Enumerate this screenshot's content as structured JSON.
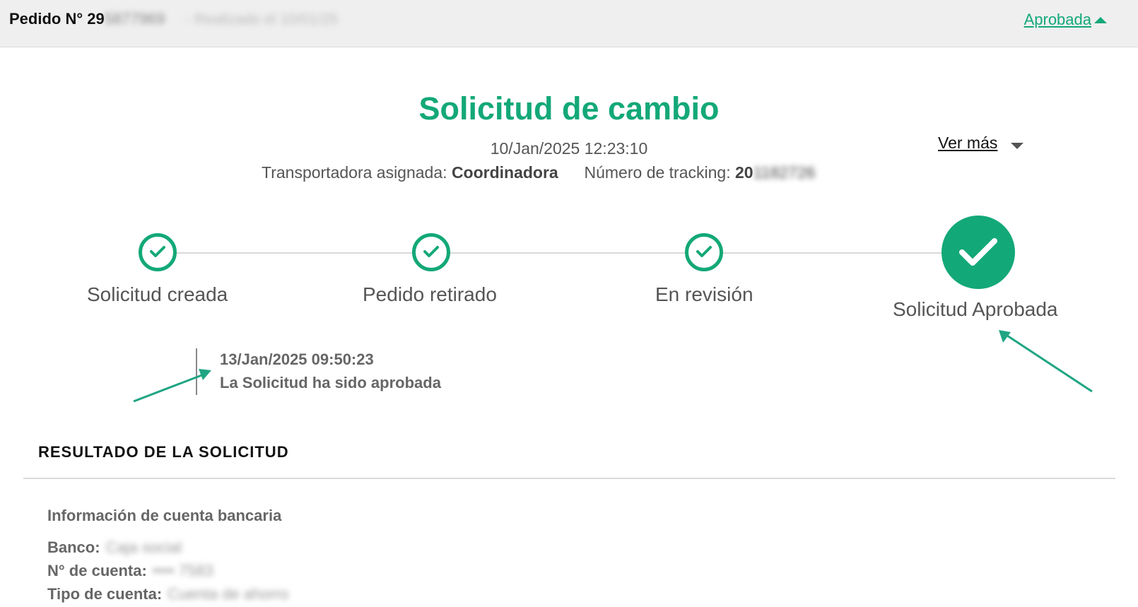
{
  "header": {
    "order_label": "Pedido N° 29",
    "order_number_hidden": "5877969",
    "order_meta": "- Realizado el 10/01/25",
    "status_link": "Aprobada"
  },
  "request": {
    "title": "Solicitud de cambio",
    "datetime": "10/Jan/2025 12:23:10",
    "see_more": "Ver más",
    "carrier_label": "Transportadora asignada:",
    "carrier_value": "Coordinadora",
    "tracking_label": "Número de tracking:",
    "tracking_value": "20",
    "tracking_hidden": "1182726"
  },
  "steps": [
    {
      "label": "Solicitud creada"
    },
    {
      "label": "Pedido retirado"
    },
    {
      "label": "En revisión"
    },
    {
      "label": "Solicitud Aprobada"
    }
  ],
  "event": {
    "date": "13/Jan/2025 09:50:23",
    "description": "La Solicitud ha sido aprobada"
  },
  "result": {
    "title": "RESULTADO DE LA SOLICITUD",
    "bank_section_title": "Información de cuenta bancaria",
    "bank_label": "Banco:",
    "bank_value": "Caja social",
    "account_label": "N° de cuenta:",
    "account_value": "•••• 7583",
    "type_label": "Tipo de cuenta:",
    "type_value": "Cuenta de ahorro"
  },
  "colors": {
    "accent": "#13a878",
    "header_bg": "#efefef",
    "text": "#555555"
  },
  "icons": [
    "check-circle-icon",
    "caret-up-icon",
    "caret-down-icon",
    "arrow-annotation-icon"
  ]
}
